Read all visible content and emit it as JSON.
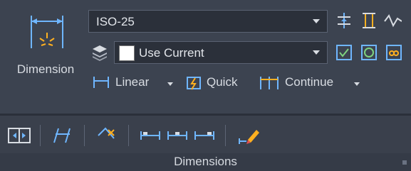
{
  "panel": {
    "title": "Dimensions",
    "dimension_button_label": "Dimension"
  },
  "style_row": {
    "dim_style_value": "ISO-25"
  },
  "layer_row": {
    "layer_value": "Use Current"
  },
  "command_row": {
    "linear_label": "Linear",
    "quick_label": "Quick",
    "continue_label": "Continue"
  },
  "colors": {
    "background": "#3c4350",
    "dropdown_bg": "#2b303a",
    "accent_green": "#7fd27f",
    "accent_blue": "#6fb6ff",
    "accent_orange": "#ffb020"
  },
  "icons": {
    "dimension": "dimension-icon",
    "layers": "layers-icon",
    "linear": "linear-icon",
    "quick": "quick-dimension-icon",
    "continue": "continue-icon"
  }
}
